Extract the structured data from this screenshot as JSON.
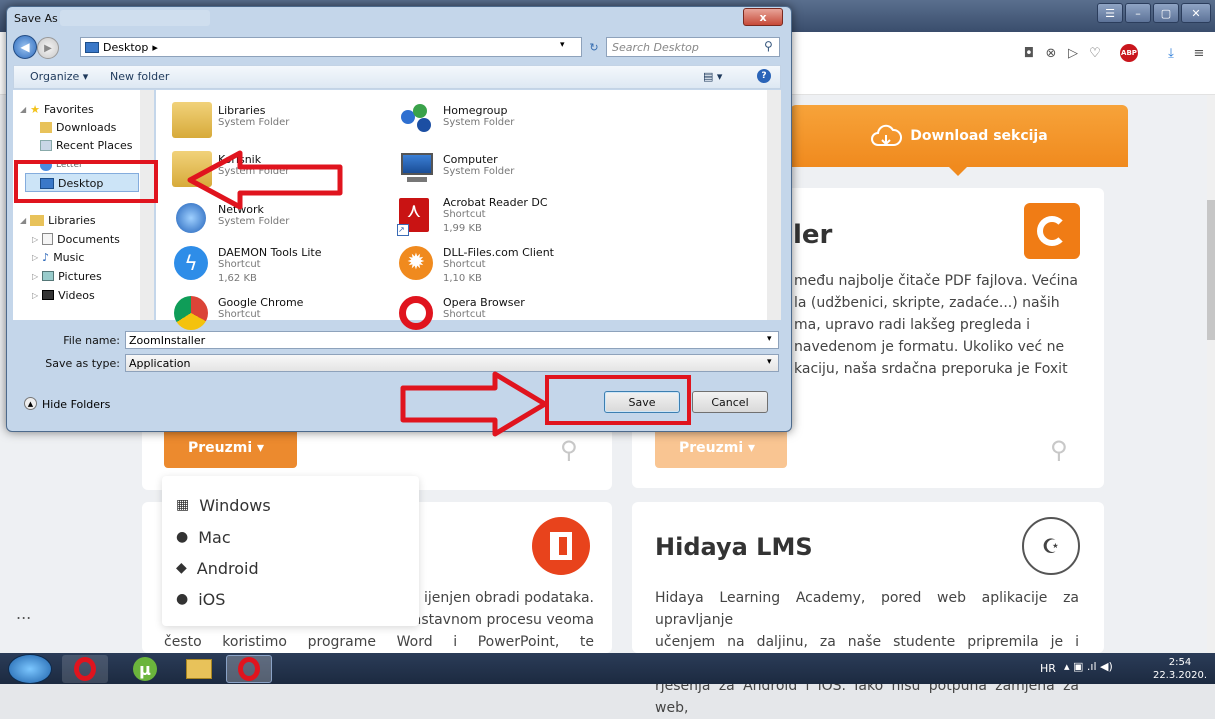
{
  "dialog": {
    "title": "Save As",
    "close_label": "x",
    "address_path": "Desktop",
    "address_sep": "▸",
    "search_placeholder": "Search Desktop",
    "toolbar": {
      "organize": "Organize ▾",
      "new_folder": "New folder"
    },
    "nav": {
      "favorites": "Favorites",
      "downloads": "Downloads",
      "recent_places": "Recent Places",
      "obscured": "Letter",
      "desktop": "Desktop",
      "libraries": "Libraries",
      "documents": "Documents",
      "music": "Music",
      "pictures": "Pictures",
      "videos": "Videos"
    },
    "files": [
      {
        "name": "Libraries",
        "sub1": "System Folder",
        "sub2": ""
      },
      {
        "name": "Homegroup",
        "sub1": "System Folder",
        "sub2": ""
      },
      {
        "name": "Korisnik",
        "sub1": "System Folder",
        "sub2": ""
      },
      {
        "name": "Computer",
        "sub1": "System Folder",
        "sub2": ""
      },
      {
        "name": "Network",
        "sub1": "System Folder",
        "sub2": ""
      },
      {
        "name": "Acrobat Reader DC",
        "sub1": "Shortcut",
        "sub2": "1,99 KB"
      },
      {
        "name": "DAEMON Tools Lite",
        "sub1": "Shortcut",
        "sub2": "1,62 KB"
      },
      {
        "name": "DLL-Files.com Client",
        "sub1": "Shortcut",
        "sub2": "1,10 KB"
      },
      {
        "name": "Google Chrome",
        "sub1": "Shortcut",
        "sub2": ""
      },
      {
        "name": "Opera Browser",
        "sub1": "Shortcut",
        "sub2": ""
      }
    ],
    "file_name_label": "File name:",
    "file_name_value": "ZoomInstaller",
    "save_type_label": "Save as type:",
    "save_type_value": "Application",
    "hide_folders": "Hide Folders",
    "save_button": "Save",
    "cancel_button": "Cancel"
  },
  "page": {
    "download_tab": "Download sekcija",
    "card1_title_fragment": "ler",
    "card1_desc": [
      "među najbolje čitače PDF fajlova. Većina",
      "la (udžbenici, skripte, zadaće...) naših",
      "ma, upravo radi lakšeg pregleda i",
      "navedenom je formatu. Ukoliko već ne",
      "kaciju, naša srdačna preporuka je Foxit"
    ],
    "preuzmi": "Preuzmi ▾",
    "dropdown": [
      "Windows",
      "Mac",
      "Android",
      "iOS"
    ],
    "left_desc": [
      "ijenjen obradi podataka.",
      "astavnom procesu veoma",
      "često koristimo programe Word i PowerPoint, te preporučujemo"
    ],
    "hidaya_title": "Hidaya LMS",
    "hidaya_desc": [
      "Hidaya Learning Academy, pored web aplikacije za upravljanje",
      "učenjem na daljinu, za naše studente pripremila je i mobilna",
      "rješenja za Android i iOS. Iako nisu potpuna zamjena za web,"
    ],
    "more_dots": "..."
  },
  "taskbar": {
    "lang": "HR",
    "time": "2:54",
    "date": "22.3.2020."
  },
  "colors": {
    "orange": "#f08a1e",
    "red_annotation": "#e0141e",
    "office_red": "#e8431c"
  }
}
